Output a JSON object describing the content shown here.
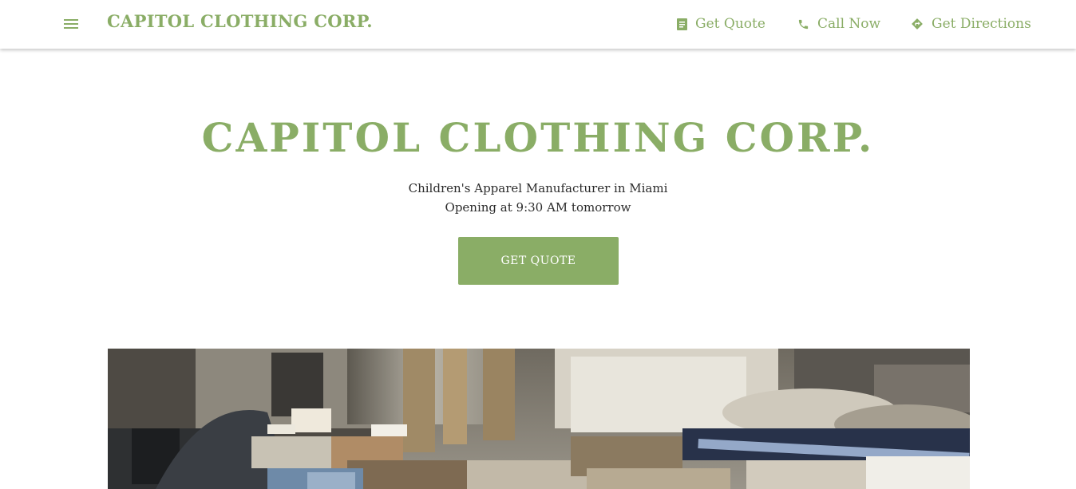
{
  "header": {
    "brand": "CAPITOL CLOTHING CORP.",
    "nav": {
      "quote_label": "Get Quote",
      "call_label": "Call Now",
      "directions_label": "Get Directions"
    }
  },
  "hero": {
    "title": "CAPITOL CLOTHING CORP.",
    "subtitle": "Children's Apparel Manufacturer in Miami",
    "hours": "Opening at 9:30 AM tomorrow",
    "cta_label": "GET QUOTE"
  },
  "icons": {
    "menu": "hamburger-menu-icon",
    "quote": "document-icon",
    "call": "phone-icon",
    "directions": "directions-icon"
  },
  "colors": {
    "accent": "#8aad66",
    "text": "#2b2b2b",
    "background": "#ffffff"
  }
}
